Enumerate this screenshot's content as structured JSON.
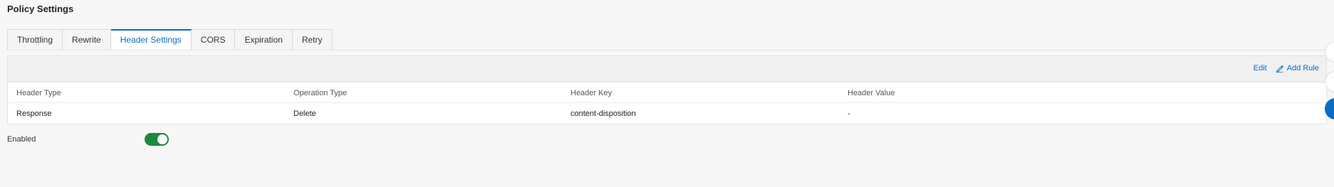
{
  "page": {
    "title": "Policy Settings"
  },
  "tabs": [
    {
      "label": "Throttling"
    },
    {
      "label": "Rewrite"
    },
    {
      "label": "Header Settings",
      "active": true
    },
    {
      "label": "CORS"
    },
    {
      "label": "Expiration"
    },
    {
      "label": "Retry"
    }
  ],
  "toolbar": {
    "edit_label": "Edit",
    "add_rule_label": "Add Rule",
    "add_rule_icon": "pencil-icon"
  },
  "table": {
    "headers": [
      "Header Type",
      "Operation Type",
      "Header Key",
      "Header Value"
    ],
    "rows": [
      [
        "Response",
        "Delete",
        "content-disposition",
        "-"
      ]
    ]
  },
  "enabled": {
    "label": "Enabled",
    "value": true
  },
  "colors": {
    "accent": "#0a6dc4",
    "switch_on": "#1b8a3c"
  }
}
